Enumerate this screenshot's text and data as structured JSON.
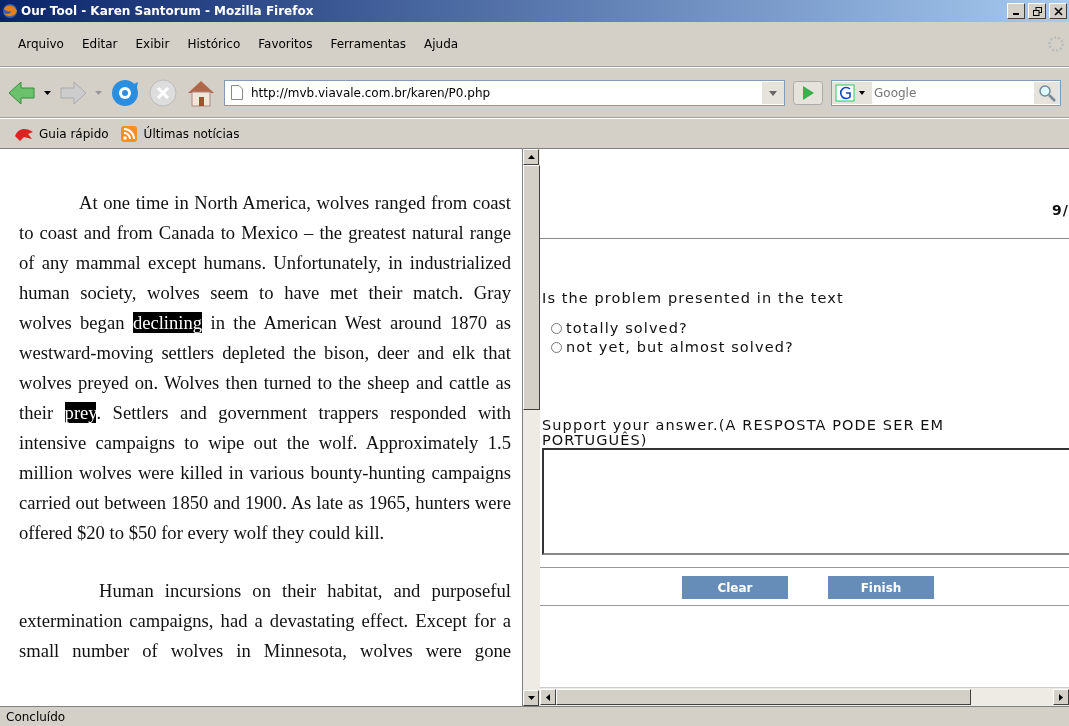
{
  "window": {
    "title": "Our Tool - Karen Santorum - Mozilla Firefox"
  },
  "menu": [
    "Arquivo",
    "Editar",
    "Exibir",
    "Histórico",
    "Favoritos",
    "Ferramentas",
    "Ajuda"
  ],
  "address": {
    "value": "http://mvb.viavale.com.br/karen/P0.php"
  },
  "search": {
    "placeholder": "Google"
  },
  "bookmarks": [
    "Guia rápido",
    "Últimas notícias"
  ],
  "text_pane": {
    "paragraphs": [
      [
        {
          "text": "At one time in North America, wolves ranged from coast to coast and from Canada to Mexico – the greatest natural range of any mammal except humans. Unfortunately, in industrialized human society, wolves seem to have met their match. Gray wolves began ",
          "highlighted": false
        },
        {
          "text": "declining",
          "highlighted": true
        },
        {
          "text": " in the American West around 1870 as westward-moving settlers depleted the bison, deer and elk that wolves preyed on. Wolves then turned to the sheep and cattle as their ",
          "highlighted": false
        },
        {
          "text": "prey",
          "highlighted": true
        },
        {
          "text": ". Settlers and government trappers responded with intensive campaigns to wipe out the wolf. Approximately 1.5 million wolves were killed in various bounty-hunting campaigns carried out between 1850 and 1900. As late as 1965, hunters were offered $20 to $50 for every wolf they could kill.",
          "highlighted": false
        }
      ],
      [
        {
          "text": "Human incursions on their habitat, and purposeful extermination campaigns, had a devastating effect. Except for a small number of wolves in Minnesota, wolves were gone",
          "highlighted": false
        }
      ]
    ]
  },
  "question_pane": {
    "counter": "9/",
    "question": "Is the problem presented in the text",
    "options": [
      {
        "label": "totally solved?",
        "selected": false
      },
      {
        "label": "not yet, but almost solved?",
        "selected": false
      }
    ],
    "support_label": "Support your answer.(A RESPOSTA PODE SER EM PORTUGUÊS)",
    "buttons": [
      "Clear",
      "Finish"
    ]
  },
  "status_bar": "Concluído"
}
